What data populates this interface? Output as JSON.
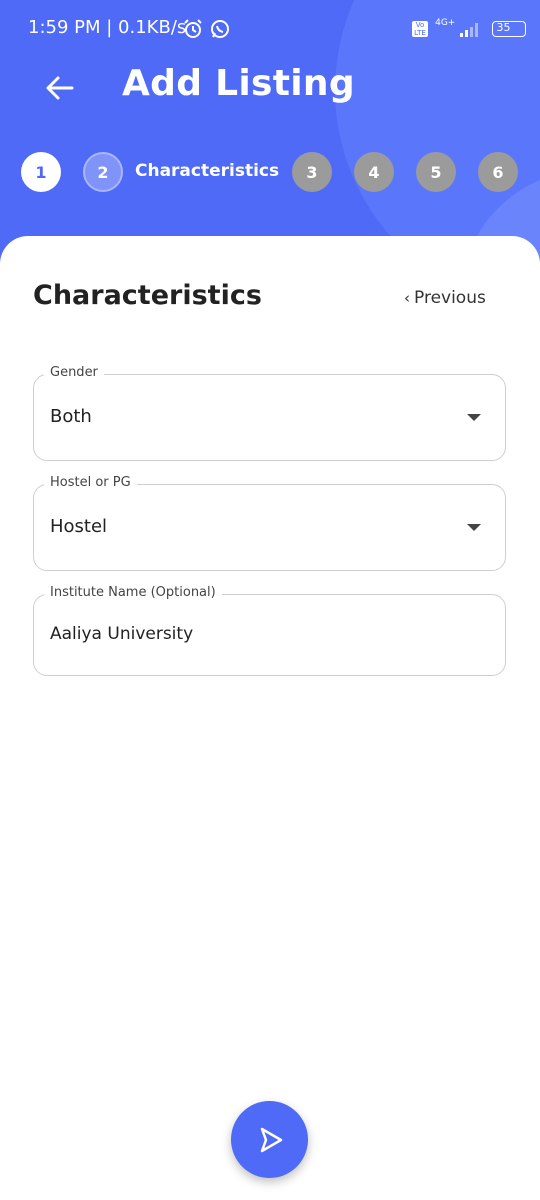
{
  "status_bar": {
    "time_speed": "1:59 PM | 0.1KB/s",
    "network": "4G+",
    "volte": "Vo LTE",
    "battery": "35"
  },
  "header": {
    "title": "Add Listing"
  },
  "stepper": {
    "steps": [
      "1",
      "2",
      "3",
      "4",
      "5",
      "6"
    ],
    "active_label": "Characteristics"
  },
  "section": {
    "title": "Characteristics",
    "previous_label": "Previous"
  },
  "fields": {
    "gender": {
      "label": "Gender",
      "value": "Both"
    },
    "hostel_or_pg": {
      "label": "Hostel or PG",
      "value": "Hostel"
    },
    "institute": {
      "label": "Institute Name (Optional)",
      "value": "Aaliya University"
    }
  },
  "colors": {
    "primary": "#4e6af6",
    "step_inactive": "#9b9b9b"
  },
  "icons": {
    "back": "arrow-left-icon",
    "next": "play-outline-icon",
    "alarm": "alarm-icon",
    "whatsapp": "whatsapp-icon"
  }
}
